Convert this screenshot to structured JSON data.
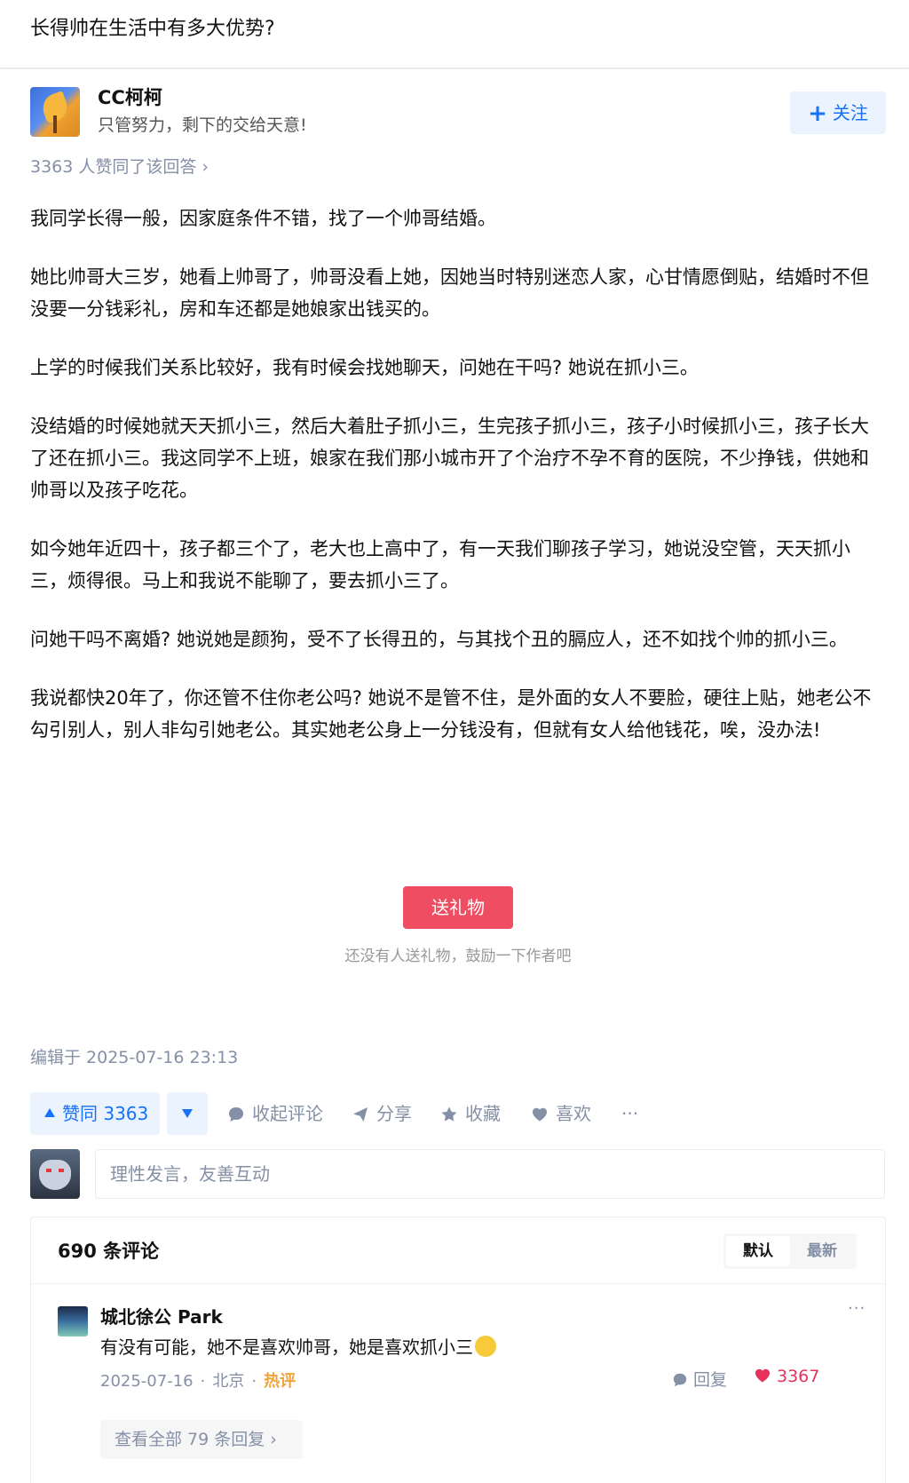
{
  "question": {
    "title": "长得帅在生活中有多大优势?"
  },
  "author": {
    "name": "CC柯柯",
    "bio": "只管努力，剩下的交给天意!",
    "follow_label": "关注",
    "avatar_icon": "avatar-image"
  },
  "answer": {
    "votes_line": "3363 人赞同了该回答 ›",
    "paragraphs": [
      "我同学长得一般，因家庭条件不错，找了一个帅哥结婚。",
      "她比帅哥大三岁，她看上帅哥了，帅哥没看上她，因她当时特别迷恋人家，心甘情愿倒贴，结婚时不但没要一分钱彩礼，房和车还都是她娘家出钱买的。",
      "上学的时候我们关系比较好，我有时候会找她聊天，问她在干吗? 她说在抓小三。",
      "没结婚的时候她就天天抓小三，然后大着肚子抓小三，生完孩子抓小三，孩子小时候抓小三，孩子长大了还在抓小三。我这同学不上班，娘家在我们那小城市开了个治疗不孕不育的医院，不少挣钱，供她和帅哥以及孩子吃花。",
      "如今她年近四十，孩子都三个了，老大也上高中了，有一天我们聊孩子学习，她说没空管，天天抓小三，烦得很。马上和我说不能聊了，要去抓小三了。",
      "问她干吗不离婚? 她说她是颜狗，受不了长得丑的，与其找个丑的膈应人，还不如找个帅的抓小三。",
      "我说都快20年了，你还管不住你老公吗? 她说不是管不住，是外面的女人不要脸，硬往上贴，她老公不勾引别人，别人非勾引她老公。其实她老公身上一分钱没有，但就有女人给他钱花，唉，没办法!"
    ],
    "gift_label": "送礼物",
    "gift_hint": "还没有人送礼物，鼓励一下作者吧",
    "edit_time": "编辑于 2025-07-16 23:13"
  },
  "actions": {
    "vote_up_label": "赞同 3363",
    "collapse_comments": "收起评论",
    "share": "分享",
    "favorite": "收藏",
    "like": "喜欢",
    "more": "···"
  },
  "comment_box": {
    "placeholder": "理性发言，友善互动"
  },
  "comments": {
    "count_label": "690 条评论",
    "sort_default": "默认",
    "sort_latest": "最新",
    "items": [
      {
        "author": "城北徐公 Park",
        "text": "有没有可能，她不是喜欢帅哥，她是喜欢抓小三",
        "date": "2025-07-16",
        "location": "北京",
        "tag": "热评",
        "reply_label": "回复",
        "likes": "3367",
        "more": "···",
        "view_all": "查看全部 79 条回复 ›"
      }
    ]
  },
  "colors": {
    "brand_blue": "#1772f6",
    "gift_red": "#ef4d61",
    "hot_tag": "#f1a33a",
    "like_red": "#e5325b"
  }
}
